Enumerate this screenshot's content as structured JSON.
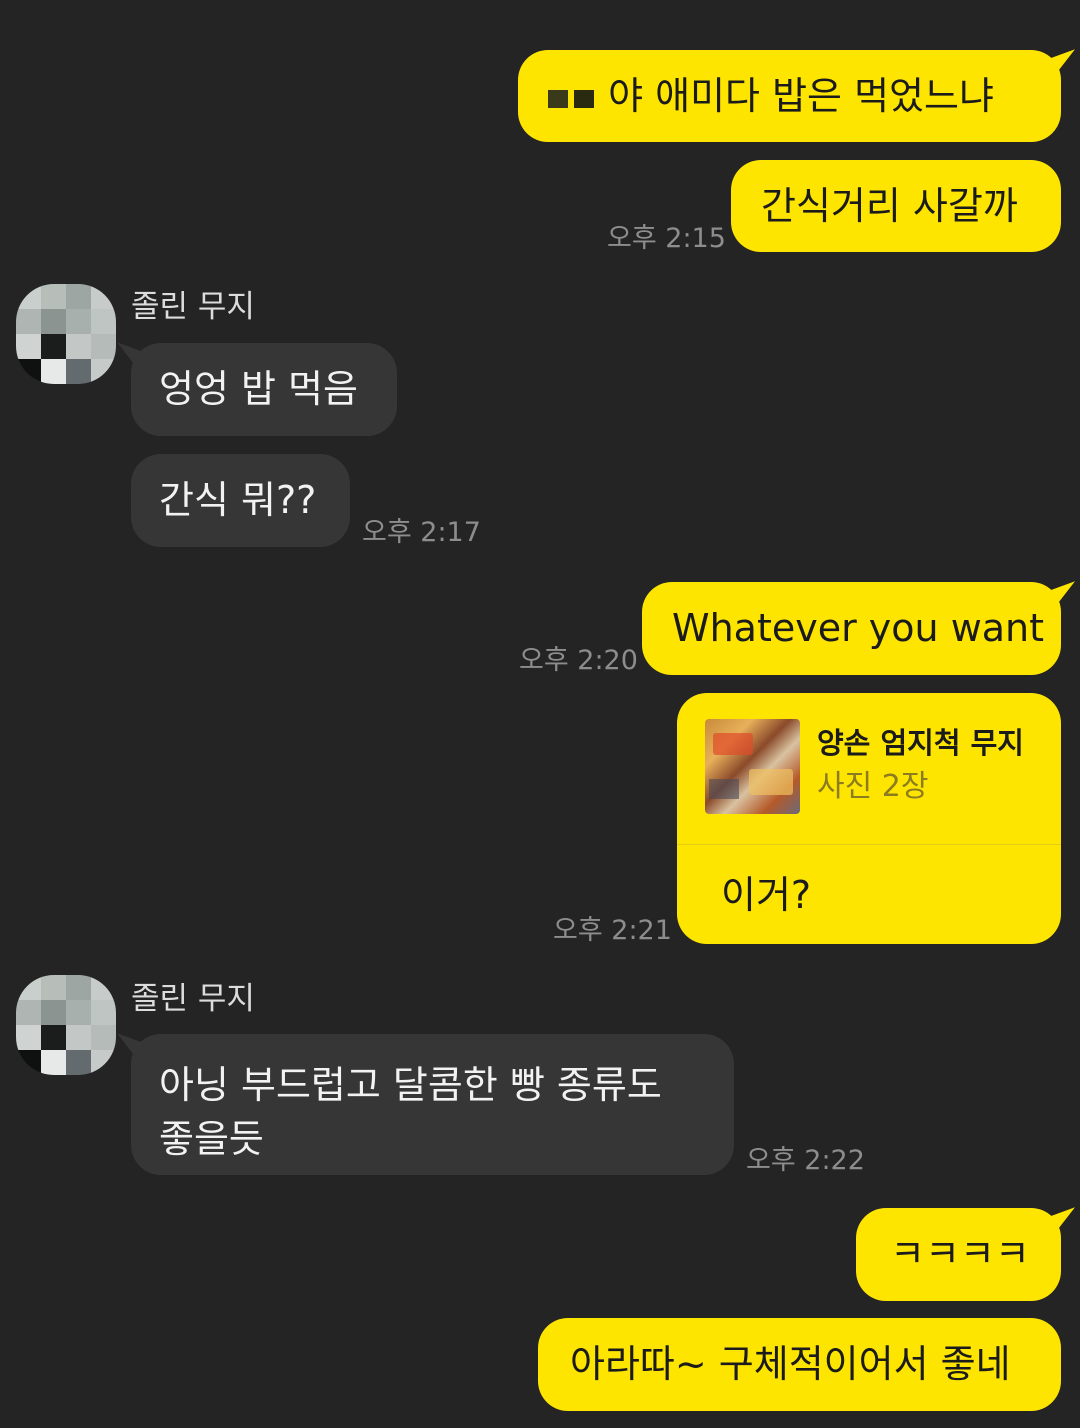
{
  "messages": {
    "m1": {
      "prefix_censored": "▀▀",
      "text": "야 애미다 밥은 먹었느냐"
    },
    "m2": {
      "text": "간식거리 사갈까",
      "time": "오후 2:15"
    },
    "group1": {
      "sender": "졸린 무지"
    },
    "m3": {
      "text": "엉엉 밥 먹음"
    },
    "m4": {
      "text": "간식 뭐??",
      "time": "오후 2:17"
    },
    "m5": {
      "text": "Whatever you want",
      "time": "오후 2:20"
    },
    "m6": {
      "card_title": "양손 엄지척 무지",
      "card_subtitle": "사진 2장",
      "text": "이거?",
      "time": "오후 2:21"
    },
    "group2": {
      "sender": "졸린 무지"
    },
    "m7": {
      "line1": "아닝 부드럽고 달콤한 빵 종류도",
      "line2": "좋을듯",
      "time": "오후 2:22"
    },
    "m8": {
      "text": "ㅋㅋㅋㅋ"
    },
    "m9": {
      "text": "아라따~ 구체적이어서 좋네"
    }
  },
  "colors": {
    "background": "#242424",
    "my_bubble": "#fee500",
    "other_bubble": "#363636",
    "timestamp": "#8d8d8d"
  }
}
